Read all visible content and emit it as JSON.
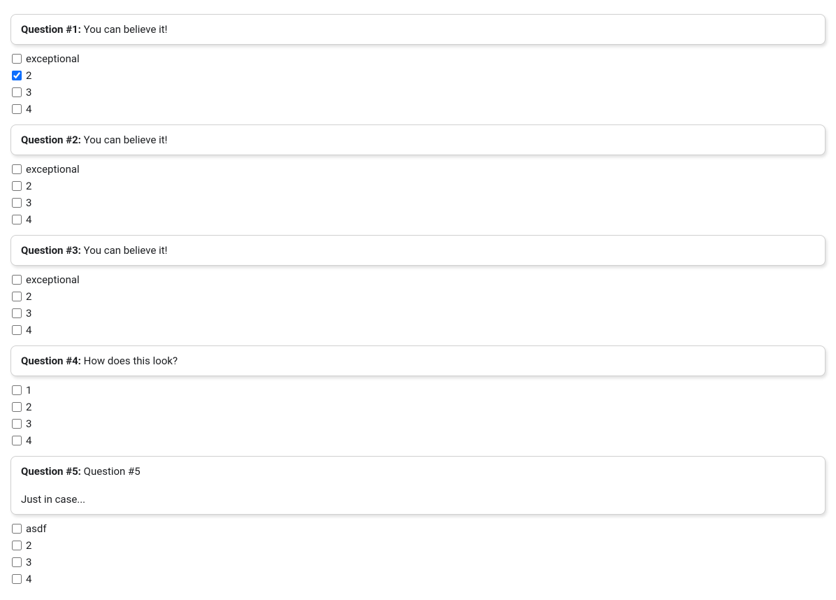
{
  "questions": [
    {
      "label": "Question #1:",
      "text": "You can believe it!",
      "subtext": null,
      "options": [
        {
          "label": "exceptional",
          "checked": false
        },
        {
          "label": "2",
          "checked": true
        },
        {
          "label": "3",
          "checked": false
        },
        {
          "label": "4",
          "checked": false
        }
      ]
    },
    {
      "label": "Question #2:",
      "text": "You can believe it!",
      "subtext": null,
      "options": [
        {
          "label": "exceptional",
          "checked": false
        },
        {
          "label": "2",
          "checked": false
        },
        {
          "label": "3",
          "checked": false
        },
        {
          "label": "4",
          "checked": false
        }
      ]
    },
    {
      "label": "Question #3:",
      "text": "You can believe it!",
      "subtext": null,
      "options": [
        {
          "label": "exceptional",
          "checked": false
        },
        {
          "label": "2",
          "checked": false
        },
        {
          "label": "3",
          "checked": false
        },
        {
          "label": "4",
          "checked": false
        }
      ]
    },
    {
      "label": "Question #4:",
      "text": "How does this look?",
      "subtext": null,
      "options": [
        {
          "label": "1",
          "checked": false
        },
        {
          "label": "2",
          "checked": false
        },
        {
          "label": "3",
          "checked": false
        },
        {
          "label": "4",
          "checked": false
        }
      ]
    },
    {
      "label": "Question #5:",
      "text": "Question #5",
      "subtext": "Just in case...",
      "options": [
        {
          "label": "asdf",
          "checked": false
        },
        {
          "label": "2",
          "checked": false
        },
        {
          "label": "3",
          "checked": false
        },
        {
          "label": "4",
          "checked": false
        }
      ]
    }
  ]
}
